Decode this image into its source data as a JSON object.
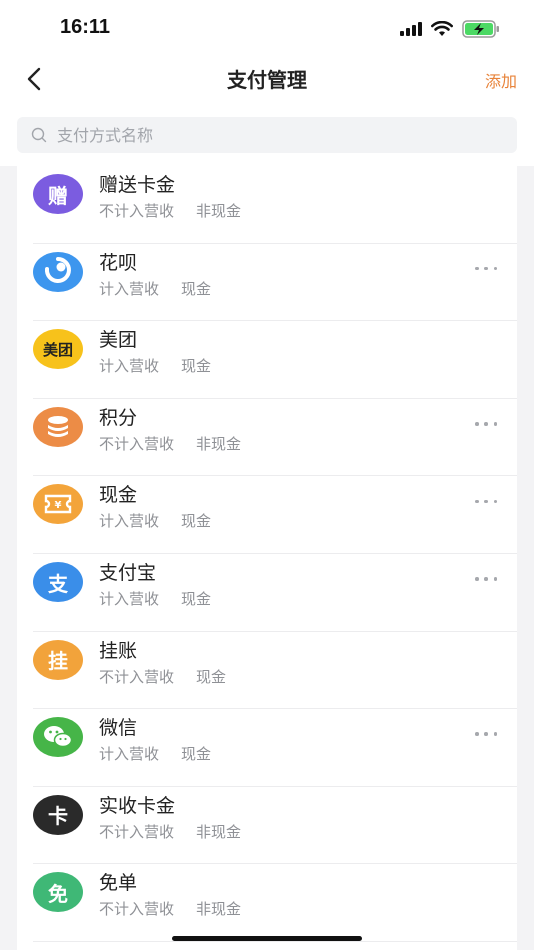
{
  "status_bar": {
    "time": "16:11"
  },
  "nav": {
    "title": "支付管理",
    "add_label": "添加",
    "back_icon": "chevron-left-icon"
  },
  "search": {
    "placeholder": "支付方式名称",
    "value": ""
  },
  "colors": {
    "accent": "#e8833a",
    "bg": "#f3f3f5",
    "tag_text": "#8f9196"
  },
  "payment_methods": [
    {
      "name": "赠送卡金",
      "tags": [
        "不计入营收",
        "非现金"
      ],
      "icon": "gift-card-icon",
      "icon_text": "赠",
      "icon_color": "#7b5ce0",
      "has_more": false
    },
    {
      "name": "花呗",
      "tags": [
        "计入营收",
        "现金"
      ],
      "icon": "huabei-icon",
      "icon_text": "",
      "icon_color": "#3d96ee",
      "has_more": true
    },
    {
      "name": "美团",
      "tags": [
        "计入营收",
        "现金"
      ],
      "icon": "meituan-icon",
      "icon_text": "美团",
      "icon_color": "#f7c21b",
      "has_more": false
    },
    {
      "name": "积分",
      "tags": [
        "不计入营收",
        "非现金"
      ],
      "icon": "points-icon",
      "icon_text": "",
      "icon_color": "#ec8c46",
      "has_more": true
    },
    {
      "name": "现金",
      "tags": [
        "计入营收",
        "现金"
      ],
      "icon": "cash-icon",
      "icon_text": "",
      "icon_color": "#f3a43a",
      "has_more": true
    },
    {
      "name": "支付宝",
      "tags": [
        "计入营收",
        "现金"
      ],
      "icon": "alipay-icon",
      "icon_text": "支",
      "icon_color": "#3a8ee9",
      "has_more": true
    },
    {
      "name": "挂账",
      "tags": [
        "不计入营收",
        "现金"
      ],
      "icon": "credit-account-icon",
      "icon_text": "挂",
      "icon_color": "#f2a33b",
      "has_more": false
    },
    {
      "name": "微信",
      "tags": [
        "计入营收",
        "现金"
      ],
      "icon": "wechat-icon",
      "icon_text": "",
      "icon_color": "#46b548",
      "has_more": true
    },
    {
      "name": "实收卡金",
      "tags": [
        "不计入营收",
        "非现金"
      ],
      "icon": "card-icon",
      "icon_text": "卡",
      "icon_color": "#2a2a2a",
      "has_more": false
    },
    {
      "name": "免单",
      "tags": [
        "不计入营收",
        "非现金"
      ],
      "icon": "free-order-icon",
      "icon_text": "免",
      "icon_color": "#3fb876",
      "has_more": false
    }
  ]
}
